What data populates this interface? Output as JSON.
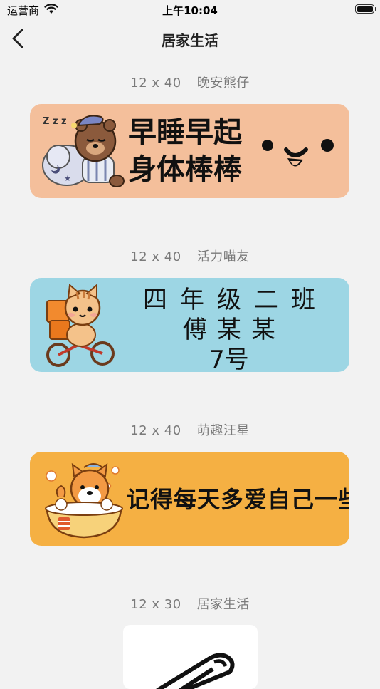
{
  "status_bar": {
    "carrier": "运营商",
    "time": "上午10:04"
  },
  "nav": {
    "title": "居家生活",
    "back_icon": "chevron-left-icon"
  },
  "labels": [
    {
      "size": "12 x 40",
      "name": "晚安熊仔",
      "lines": [
        "早睡早起",
        "身体棒棒"
      ],
      "background": "#f4bf9b"
    },
    {
      "size": "12 x 40",
      "name": "活力喵友",
      "lines": [
        "四年级二班",
        "傅某某",
        "7号"
      ],
      "background": "#9dd6e4"
    },
    {
      "size": "12 x 40",
      "name": "萌趣汪星",
      "lines": [
        "记得每天多爱自己一些"
      ],
      "background": "#f5b043"
    },
    {
      "size": "12 x 30",
      "name": "居家生活",
      "lines": [],
      "background": "#ffffff"
    }
  ]
}
